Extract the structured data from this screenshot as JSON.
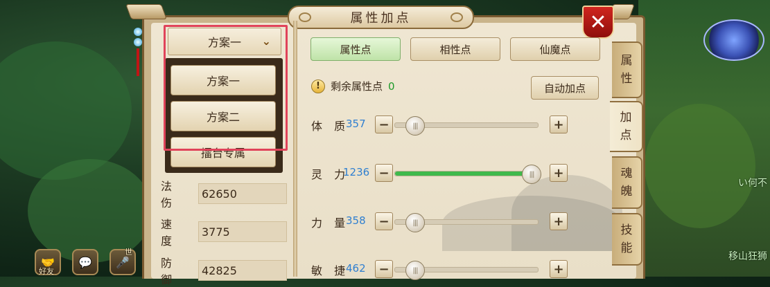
{
  "window": {
    "title": "属性加点",
    "close_glyph": "✕"
  },
  "scheme": {
    "selected": "方案一",
    "options": [
      "方案一",
      "方案二",
      "擂台专属"
    ]
  },
  "stats": [
    {
      "label": "法 伤",
      "value": "62650"
    },
    {
      "label": "速 度",
      "value": "3775"
    },
    {
      "label": "防 御",
      "value": "42825"
    }
  ],
  "tabs": [
    {
      "label": "属性点",
      "active": true
    },
    {
      "label": "相性点",
      "active": false
    },
    {
      "label": "仙魔点",
      "active": false
    }
  ],
  "remaining": {
    "label": "剩余属性点",
    "value": "0",
    "icon": "!"
  },
  "auto_button": "自动加点",
  "attributes": [
    {
      "label": "体 质",
      "value": "357",
      "slider": 0.0
    },
    {
      "label": "灵 力",
      "value": "1236",
      "slider": 1.0
    },
    {
      "label": "力 量",
      "value": "358",
      "slider": 0.0
    },
    {
      "label": "敏 捷",
      "value": "462",
      "slider": 0.0
    }
  ],
  "side_tabs": [
    "属性",
    "加点",
    "魂魄",
    "技能"
  ],
  "hud": {
    "friends": "好友",
    "voice_tag": "世"
  },
  "world": {
    "text1": "い何不",
    "text2": "移山狂狮"
  },
  "colors": {
    "accent_green": "#3fb94c",
    "value_blue": "#2f7fd0",
    "highlight_red": "#e0435a",
    "close_red": "#d0261f"
  }
}
